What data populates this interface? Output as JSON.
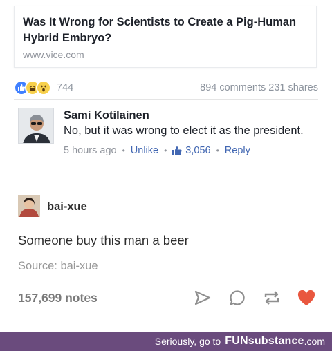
{
  "link_card": {
    "title": "Was It Wrong for Scientists to Create a Pig-Human Hybrid Embryo?",
    "domain": "www.vice.com"
  },
  "reactions": {
    "icons": [
      "like-icon",
      "haha-icon",
      "wow-icon"
    ],
    "count": "744",
    "stats": "894 comments 231 shares"
  },
  "comment": {
    "author": "Sami Kotilainen",
    "text": "No, but it was wrong to elect it as the president.",
    "time": "5 hours ago",
    "unlike_label": "Unlike",
    "like_count": "3,056",
    "reply_label": "Reply"
  },
  "tumblr": {
    "username": "bai-xue",
    "text": "Someone buy this man a beer",
    "source": "Source: bai-xue",
    "notes": "157,699 notes",
    "icons": [
      "share-icon",
      "comment-icon",
      "reblog-icon",
      "heart-icon"
    ],
    "heart_color": "#e9573f"
  },
  "watermark": {
    "prefix": "Seriously, go to",
    "brand": "FUNsubstance",
    "suffix": ".com",
    "bar_color": "#6a4b7d"
  }
}
